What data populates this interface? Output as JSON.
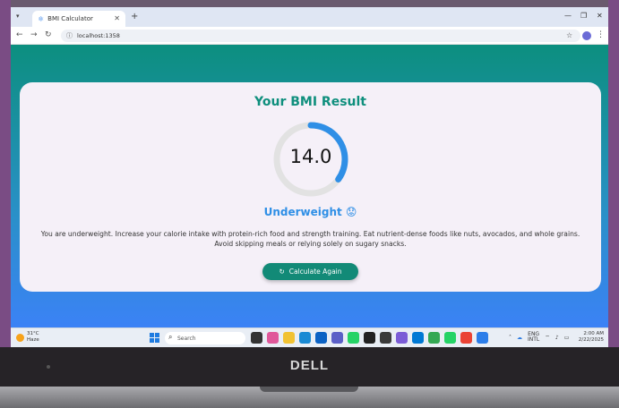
{
  "browser": {
    "tab_title": "BMI Calculator",
    "url": "localhost:1358"
  },
  "card": {
    "title": "Your BMI Result",
    "bmi_value": "14.0",
    "gauge_fraction": 0.35,
    "category": "Underweight 😟",
    "advice": "You are underweight. Increase your calorie intake with protein-rich food and strength training. Eat nutrient-dense foods like nuts, avocados, and whole grains. Avoid skipping meals or relying solely on sugary snacks.",
    "button_label": "Calculate Again"
  },
  "taskbar": {
    "weather_temp": "31°C",
    "weather_desc": "Haze",
    "search_placeholder": "Search",
    "lang_top": "ENG",
    "lang_bottom": "INTL",
    "time": "2:00 AM",
    "date": "2/22/2025"
  },
  "colors": {
    "accent_teal": "#0f8f7d",
    "gauge_blue": "#2f8fe6",
    "gauge_track": "#e2e2e2"
  },
  "laptop": {
    "brand": "DELL"
  }
}
